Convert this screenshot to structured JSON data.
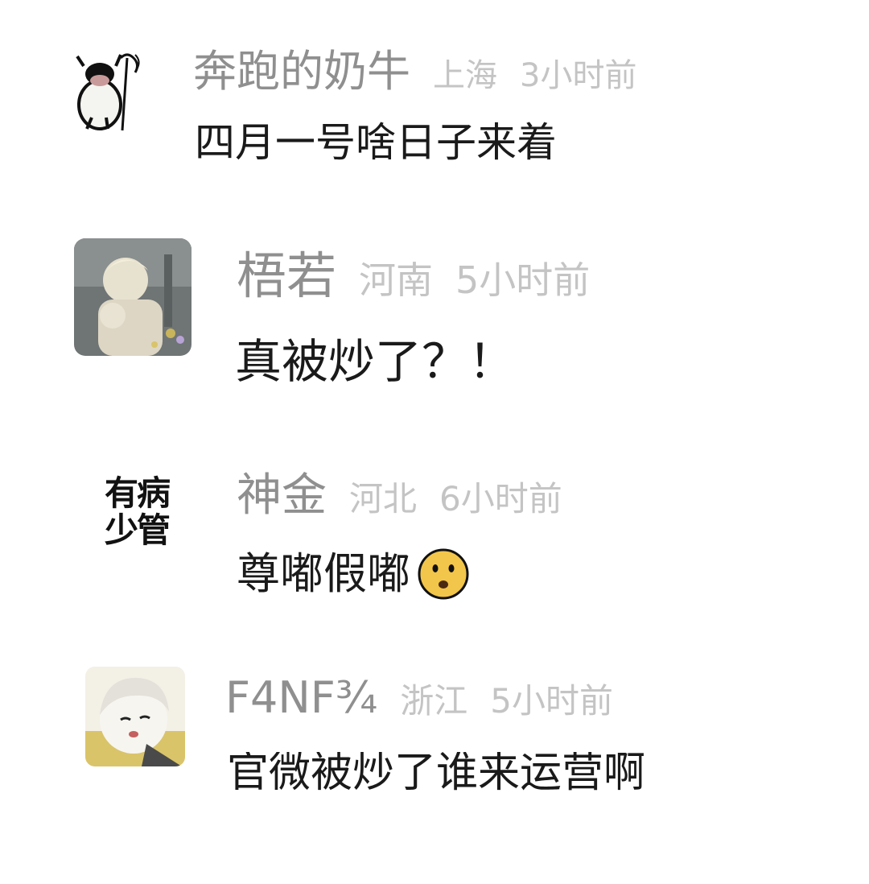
{
  "comments": [
    {
      "username": "奔跑的奶牛",
      "location": "上海",
      "time": "3小时前",
      "text": "四月一号啥日子来着",
      "avatar": "cow-drawing"
    },
    {
      "username": "梧若",
      "location": "河南",
      "time": "5小时前",
      "text": "真被炒了？！",
      "avatar": "anime-illustration"
    },
    {
      "username": "神金",
      "location": "河北",
      "time": "6小时前",
      "text": "尊嘟假嘟",
      "avatar_text": "有病少管",
      "emoji": "frowning-face-icon"
    },
    {
      "username": "F4NF¾",
      "location": "浙江",
      "time": "5小时前",
      "text": "官微被炒了谁来运营啊",
      "avatar": "anime-girl"
    }
  ]
}
